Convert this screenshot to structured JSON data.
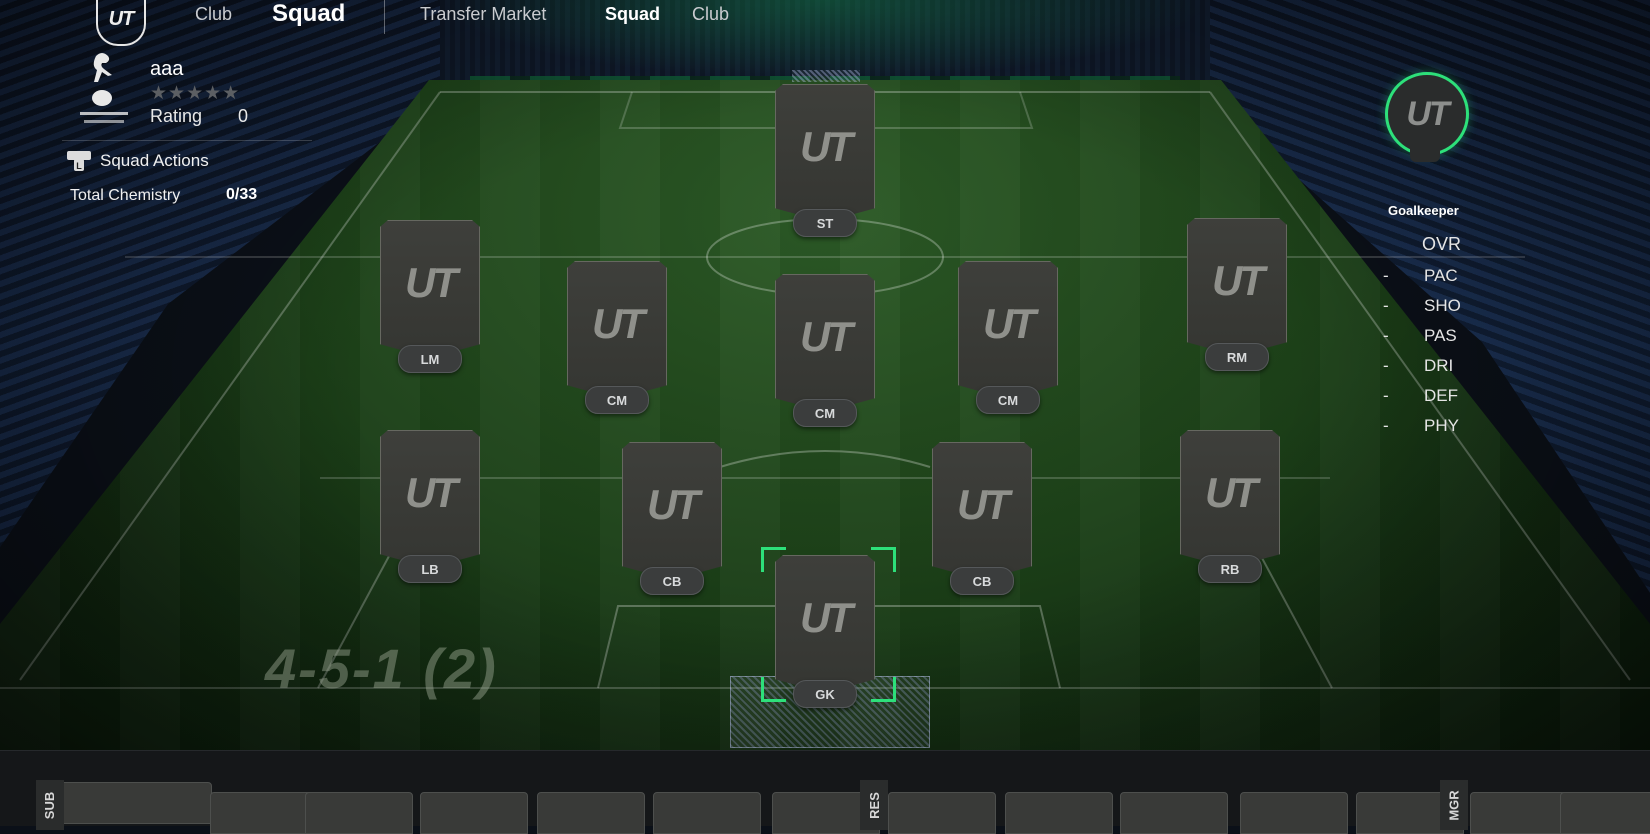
{
  "nav": {
    "logo_text": "UT",
    "club_label": "Club",
    "squad_heading": "Squad",
    "tabs": [
      "Transfer Market",
      "Squad",
      "Club"
    ],
    "active_tab": "Squad",
    "accent_color": "#2de07a"
  },
  "squad": {
    "name": "aaa",
    "stars": "★★★★★",
    "star_rating": 0,
    "rating_label": "Rating",
    "rating_value": "0",
    "actions_label": "Squad Actions",
    "chemistry_label": "Total Chemistry",
    "chemistry_value": "0/33"
  },
  "formation": "4-5-1 (2)",
  "players": [
    {
      "position": "ST",
      "logo": "UT"
    },
    {
      "position": "LM",
      "logo": "UT"
    },
    {
      "position": "CM",
      "logo": "UT"
    },
    {
      "position": "CM",
      "logo": "UT"
    },
    {
      "position": "CM",
      "logo": "UT"
    },
    {
      "position": "RM",
      "logo": "UT"
    },
    {
      "position": "LB",
      "logo": "UT"
    },
    {
      "position": "CB",
      "logo": "UT"
    },
    {
      "position": "CB",
      "logo": "UT"
    },
    {
      "position": "RB",
      "logo": "UT"
    },
    {
      "position": "GK",
      "logo": "UT",
      "selected": true
    }
  ],
  "selected_panel": {
    "badge_text": "UT",
    "position_title": "Goalkeeper",
    "ovr_label": "OVR",
    "stats": [
      {
        "dash": "-",
        "name": "PAC"
      },
      {
        "dash": "-",
        "name": "SHO"
      },
      {
        "dash": "-",
        "name": "PAS"
      },
      {
        "dash": "-",
        "name": "DRI"
      },
      {
        "dash": "-",
        "name": "DEF"
      },
      {
        "dash": "-",
        "name": "PHY"
      }
    ]
  },
  "bench": {
    "tabs": [
      "SUB",
      "RES",
      "MGR"
    ]
  }
}
